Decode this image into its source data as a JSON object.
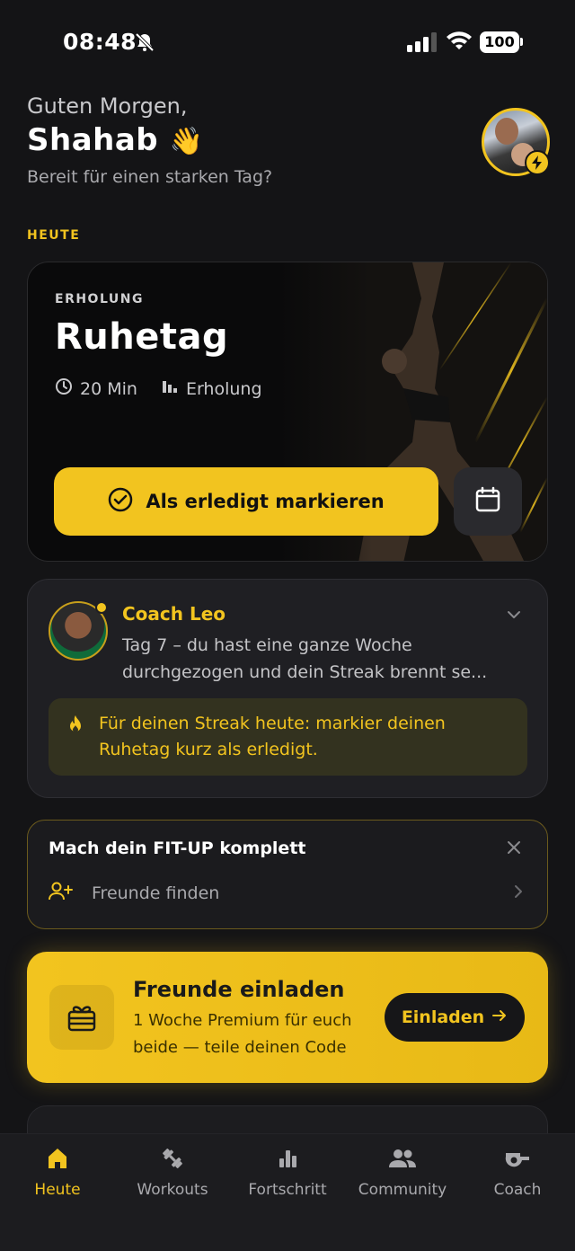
{
  "status": {
    "time": "08:48",
    "battery": "100"
  },
  "header": {
    "greeting": "Guten Morgen,",
    "name": "Shahab",
    "wave": "👋",
    "subtitle": "Bereit für einen starken Tag?"
  },
  "today_label": "HEUTE",
  "workout": {
    "category": "ERHOLUNG",
    "title": "Ruhetag",
    "duration": "20 Min",
    "level": "Erholung",
    "done_button": "Als erledigt markieren"
  },
  "coach": {
    "name": "Coach Leo",
    "message": "Tag 7 – du hast eine ganze Woche durchgezogen und dein Streak brennt se...",
    "tip": "Für deinen Streak heute: markier deinen Ruhetag kurz als erledigt."
  },
  "fitup": {
    "title": "Mach dein FIT-UP komplett",
    "row_label": "Freunde finden"
  },
  "invite": {
    "title": "Freunde einladen",
    "subtitle": "1 Woche Premium für euch beide — teile deinen Code",
    "button": "Einladen"
  },
  "tabs": [
    {
      "label": "Heute",
      "icon": "home-icon",
      "active": true
    },
    {
      "label": "Workouts",
      "icon": "dumbbell-icon",
      "active": false
    },
    {
      "label": "Fortschritt",
      "icon": "bar-chart-icon",
      "active": false
    },
    {
      "label": "Community",
      "icon": "people-icon",
      "active": false
    },
    {
      "label": "Coach",
      "icon": "whistle-icon",
      "active": false
    }
  ],
  "colors": {
    "accent": "#f2c41f",
    "background": "#141416",
    "card": "#1f1f23"
  }
}
